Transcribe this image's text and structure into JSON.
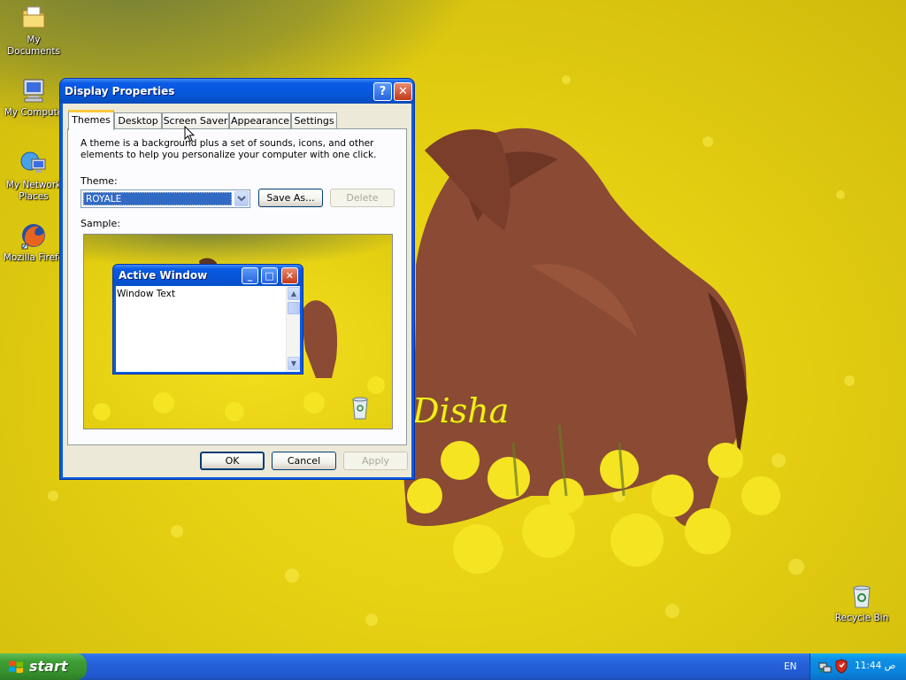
{
  "desktop": {
    "icons": [
      {
        "label": "My Documents",
        "icon": "my-documents-icon"
      },
      {
        "label": "My Compute",
        "icon": "my-computer-icon"
      },
      {
        "label": "My Network Places",
        "icon": "network-places-icon"
      },
      {
        "label": "Mozilla Firefo",
        "icon": "firefox-icon"
      },
      {
        "label": "Recycle Bin",
        "icon": "recycle-bin-icon"
      }
    ],
    "wallpaper_caption": "Disha"
  },
  "window": {
    "title": "Display Properties",
    "help_glyph": "?",
    "close_glyph": "✕",
    "tabs": [
      {
        "label": "Themes",
        "active": true
      },
      {
        "label": "Desktop",
        "active": false
      },
      {
        "label": "Screen Saver",
        "active": false
      },
      {
        "label": "Appearance",
        "active": false
      },
      {
        "label": "Settings",
        "active": false
      }
    ],
    "description": "A theme is a background plus a set of sounds, icons, and other elements to help you personalize your computer with one click.",
    "theme_label": "Theme:",
    "theme_value": "ROYALE",
    "save_as_label": "Save As...",
    "delete_label": "Delete",
    "sample_label": "Sample:",
    "sample": {
      "window_title": "Active Window",
      "window_text": "Window Text",
      "minimize_glyph": "_",
      "maximize_glyph": "□",
      "close_glyph": "✕"
    },
    "ok_label": "OK",
    "cancel_label": "Cancel",
    "apply_label": "Apply"
  },
  "taskbar": {
    "start_label": "start",
    "language": "EN",
    "clock": "11:44 ص"
  },
  "colors": {
    "xp_blue": "#0a5ae0",
    "start_green": "#3e9e35",
    "tray_blue": "#0a84dc",
    "tab_highlight": "#ffc83c"
  }
}
